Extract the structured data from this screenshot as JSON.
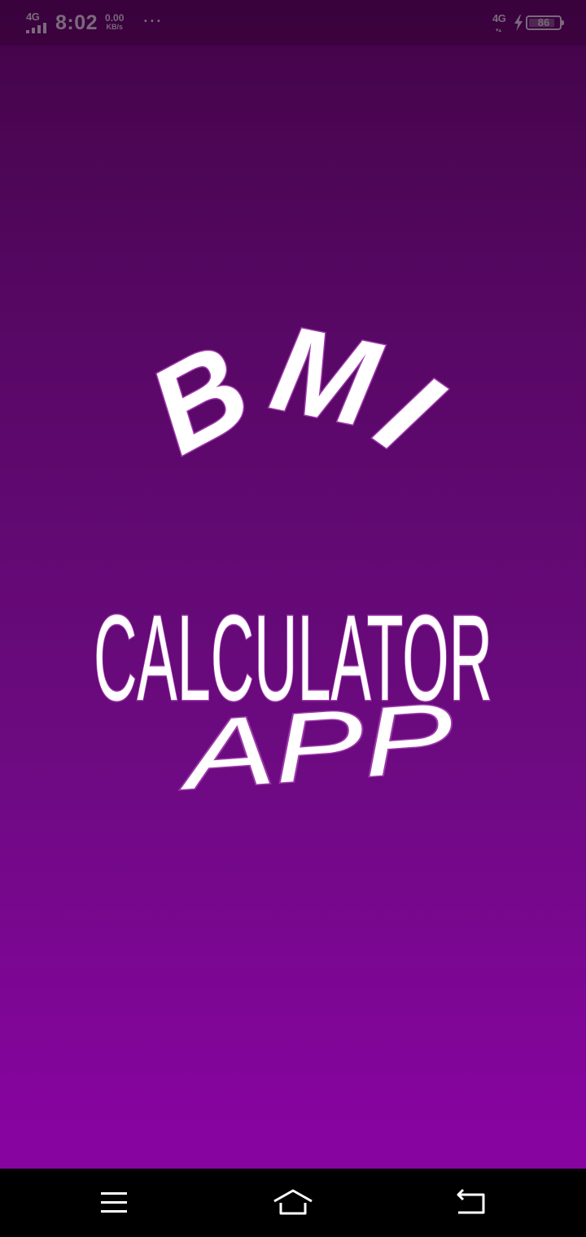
{
  "status_bar": {
    "network_label": "4G",
    "time": "8:02",
    "speed_value": "0.00",
    "speed_unit": "KB/s",
    "overflow_dots": "···",
    "network_label_right": "4G",
    "battery_percent": "86",
    "battery_level": 0.86,
    "icon_color": "#7a6a7a"
  },
  "splash": {
    "logo_lines": [
      "BMI",
      "CALCULATOR",
      "APP"
    ],
    "logo_text_color": "#ffffff",
    "logo_outline_color": "#9c3aa8"
  },
  "background": {
    "top_color": "#430448",
    "bottom_color": "#8a05a2"
  },
  "nav_bar": {
    "background": "#000000",
    "buttons": [
      {
        "name": "menu-icon"
      },
      {
        "name": "home-icon"
      },
      {
        "name": "back-icon"
      }
    ]
  }
}
